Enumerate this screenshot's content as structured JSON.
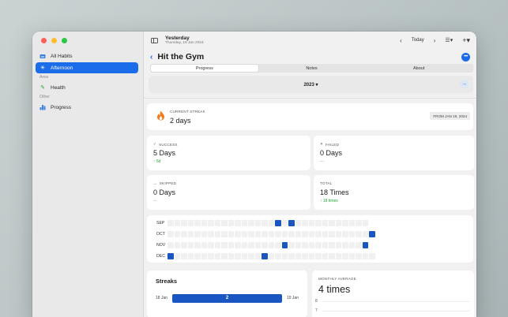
{
  "window": {
    "toolbar": {
      "title": "Yesterday",
      "subtitle": "Thursday, 18 Jan 2024",
      "today_label": "Today"
    }
  },
  "sidebar": {
    "items_top": [
      {
        "label": "All Habits",
        "icon": "tray-icon",
        "active": false
      },
      {
        "label": "Afternoon",
        "icon": "sun-icon",
        "active": true
      }
    ],
    "sections": [
      {
        "title": "Area",
        "items": [
          {
            "label": "Health",
            "icon": "hammer-icon"
          }
        ]
      },
      {
        "title": "Other",
        "items": [
          {
            "label": "Progress",
            "icon": "chart-icon"
          }
        ]
      }
    ]
  },
  "habit": {
    "title": "Hit the Gym",
    "tabs": [
      {
        "label": "Progress",
        "selected": true
      },
      {
        "label": "Notes",
        "selected": false
      },
      {
        "label": "About",
        "selected": false
      }
    ],
    "year": "2023"
  },
  "current_streak": {
    "caption": "CURRENT STREAK",
    "value": "2 days",
    "from": "FROM JAN 18, 2024"
  },
  "stats": {
    "success": {
      "caption": "SUCCESS",
      "value": "5 Days",
      "sub": "5d"
    },
    "failed": {
      "caption": "FAILED",
      "value": "0 Days",
      "sub": "---"
    },
    "skipped": {
      "caption": "SKIPPED",
      "value": "0 Days",
      "sub": "---"
    },
    "total": {
      "caption": "TOTAL",
      "value": "18 Times",
      "sub": "18 times"
    }
  },
  "heatmap": {
    "rows": [
      {
        "month": "SEP",
        "cells": 30,
        "on": [
          16,
          18
        ]
      },
      {
        "month": "OCT",
        "cells": 31,
        "on": [
          30
        ]
      },
      {
        "month": "NOV",
        "cells": 30,
        "on": [
          17,
          29
        ]
      },
      {
        "month": "DEC",
        "cells": 31,
        "on": [
          0,
          14
        ]
      }
    ]
  },
  "streaks": {
    "title": "Streaks",
    "start": "18 Jan",
    "end": "19 Jan",
    "value": "2"
  },
  "monthly_average": {
    "caption": "MONTHLY AVERAGE",
    "value": "4 times",
    "ticks": [
      "8",
      "7"
    ]
  },
  "colors": {
    "accent": "#1a6ce8",
    "heat_on": "#1a56c2",
    "success_green": "#20a436",
    "flame": "#f57c1f"
  }
}
